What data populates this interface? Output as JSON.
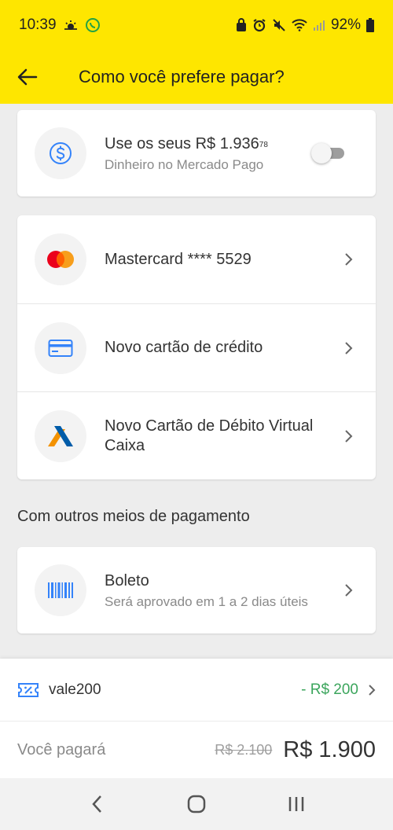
{
  "status_bar": {
    "time": "10:39",
    "battery": "92%"
  },
  "header": {
    "title": "Como você prefere pagar?"
  },
  "balance": {
    "title": "Use os seus R$ 1.936",
    "cents": "78",
    "subtitle": "Dinheiro no Mercado Pago",
    "toggle_on": false
  },
  "payment_methods": [
    {
      "title": "Mastercard **** 5529",
      "icon": "mastercard-icon"
    },
    {
      "title": "Novo cartão de crédito",
      "icon": "credit-card-icon"
    },
    {
      "title": "Novo Cartão de Débito Virtual Caixa",
      "icon": "caixa-icon"
    }
  ],
  "other_section": {
    "title": "Com outros meios de pagamento",
    "boleto": {
      "title": "Boleto",
      "subtitle": "Será aprovado em 1 a 2 dias úteis",
      "icon": "barcode-icon"
    }
  },
  "summary": {
    "coupon_code": "vale200",
    "coupon_discount": "- R$ 200",
    "pay_label": "Você pagará",
    "old_price": "R$ 2.100",
    "new_price": "R$ 1.900"
  },
  "colors": {
    "brand_yellow": "#fee600",
    "accent_blue": "#3483fa",
    "discount_green": "#3ba55c"
  }
}
